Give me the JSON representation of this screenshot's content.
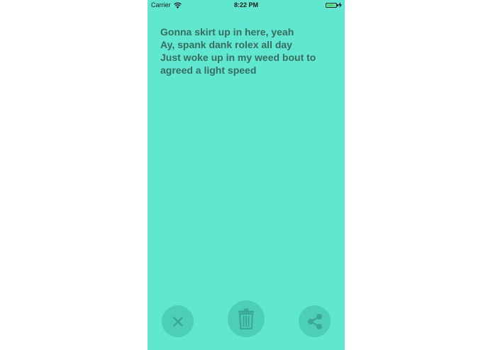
{
  "status_bar": {
    "carrier": "Carrier",
    "time": "8:22 PM",
    "battery_level": 0.85,
    "battery_color": "#4cd964"
  },
  "note": {
    "lines": [
      "Gonna skirt up in here, yeah",
      "Ay, spank dank rolex all day",
      "Just woke up in my weed bout to",
      "agreed a light speed"
    ]
  },
  "actions": {
    "close_icon": "close-icon",
    "delete_icon": "trash-icon",
    "share_icon": "share-icon"
  },
  "colors": {
    "background": "#5fe8cf",
    "text": "#3b6a5f",
    "button": "#4ccfb6",
    "icon": "#3aa893"
  }
}
